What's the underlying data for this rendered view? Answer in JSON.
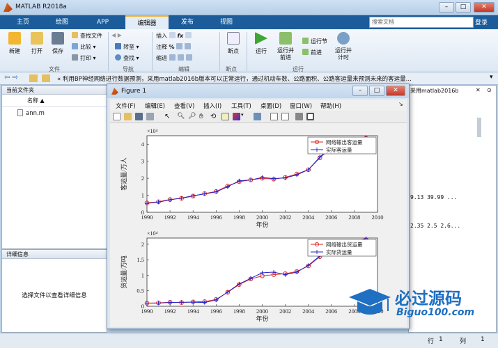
{
  "window": {
    "title": "MATLAB R2018a"
  },
  "tabs": [
    "主页",
    "绘图",
    "APP",
    "编辑器",
    "发布",
    "视图"
  ],
  "search": {
    "placeholder": "搜索文档"
  },
  "login": "登录",
  "ribbon": {
    "new": "新建",
    "open": "打开",
    "save": "保存",
    "find_files": "查找文件",
    "compare": "比较",
    "print": "打印",
    "goto": "转至",
    "find": "查找",
    "insert": "插入",
    "comment": "注释",
    "indent": "缩进",
    "breakpoints": "断点",
    "run": "运行",
    "run_advance": "运行并\n前进",
    "run_section": "运行节",
    "advance": "前进",
    "run_time": "运行并\n计时",
    "groups": {
      "file": "文件",
      "navigate": "导航",
      "edit": "编辑",
      "breakpoints": "断点",
      "run": "运行"
    }
  },
  "address": {
    "path": "« 利用BP神经网络进行数据预测，采用matlab2016b版本可以正常运行，通过机动车数、公路面积、公路客运量来预测未来的客运量..."
  },
  "current_folder": {
    "title": "当前文件夹",
    "col_name": "名称",
    "files": [
      "ann.m"
    ]
  },
  "details": {
    "title": "详细信息",
    "hint": "选择文件以查看详细信息"
  },
  "right_snippets": {
    "header": "采用matlab2016b",
    "line1": "9.13 39.99 ...",
    "line2": "2.35 2.5 2.6..."
  },
  "status": {
    "row_label": "行",
    "row": "1",
    "col_label": "列",
    "col": "1"
  },
  "figure": {
    "title": "Figure 1",
    "menu": [
      "文件(F)",
      "编辑(E)",
      "查看(V)",
      "插入(I)",
      "工具(T)",
      "桌面(D)",
      "窗口(W)",
      "帮助(H)"
    ]
  },
  "chart_data": [
    {
      "type": "line",
      "xlabel": "年份",
      "ylabel": "客运量/万人",
      "exponent": "×10⁴",
      "xlim": [
        1990,
        2010
      ],
      "ylim": [
        0,
        4.5
      ],
      "xticks": [
        "1990",
        "1992",
        "1994",
        "1996",
        "1998",
        "2000",
        "2002",
        "2004",
        "2006",
        "2008",
        "2010"
      ],
      "yticks": [
        "0",
        "1",
        "2",
        "3",
        "4"
      ],
      "x": [
        1990,
        1991,
        1992,
        1993,
        1994,
        1995,
        1996,
        1997,
        1998,
        1999,
        2000,
        2001,
        2002,
        2003,
        2004,
        2005,
        2006,
        2007,
        2008,
        2009
      ],
      "series": [
        {
          "name": "网络输出客运量",
          "color": "#d22",
          "marker": "o",
          "values": [
            0.55,
            0.62,
            0.75,
            0.82,
            0.95,
            1.1,
            1.22,
            1.55,
            1.8,
            1.9,
            2.0,
            1.95,
            2.05,
            2.25,
            2.5,
            3.2,
            3.8,
            4.05,
            4.25,
            4.35
          ]
        },
        {
          "name": "实际客运量",
          "color": "#22c",
          "marker": "+",
          "values": [
            0.52,
            0.6,
            0.73,
            0.84,
            0.97,
            1.08,
            1.2,
            1.5,
            1.85,
            1.9,
            2.05,
            1.98,
            2.02,
            2.2,
            2.5,
            3.25,
            3.85,
            4.1,
            4.3,
            4.4
          ]
        }
      ]
    },
    {
      "type": "line",
      "xlabel": "年份",
      "ylabel": "货运量/万吨",
      "exponent": "×10⁴",
      "xlim": [
        1990,
        2010
      ],
      "ylim": [
        0,
        2.2
      ],
      "xticks": [
        "1990",
        "1992",
        "1994",
        "1996",
        "1998",
        "2000",
        "2002",
        "2004",
        "2006",
        "2008",
        "2010"
      ],
      "yticks": [
        "0",
        "0.5",
        "1",
        "1.5",
        "2"
      ],
      "x": [
        1990,
        1991,
        1992,
        1993,
        1994,
        1995,
        1996,
        1997,
        1998,
        1999,
        2000,
        2001,
        2002,
        2003,
        2004,
        2005,
        2006,
        2007,
        2008,
        2009
      ],
      "series": [
        {
          "name": "网络输出货运量",
          "color": "#d22",
          "marker": "o",
          "values": [
            0.1,
            0.11,
            0.13,
            0.12,
            0.14,
            0.15,
            0.22,
            0.45,
            0.7,
            0.88,
            0.98,
            1.02,
            1.05,
            1.12,
            1.3,
            1.6,
            1.85,
            2.0,
            2.08,
            2.15
          ]
        },
        {
          "name": "实际货运量",
          "color": "#22c",
          "marker": "+",
          "values": [
            0.1,
            0.1,
            0.12,
            0.13,
            0.13,
            0.12,
            0.2,
            0.46,
            0.72,
            0.9,
            1.08,
            1.1,
            1.02,
            1.1,
            1.32,
            1.62,
            1.88,
            2.02,
            2.1,
            2.18
          ]
        }
      ]
    }
  ],
  "watermark": {
    "brand": "必过源码",
    "site": "Biguo100.com"
  }
}
